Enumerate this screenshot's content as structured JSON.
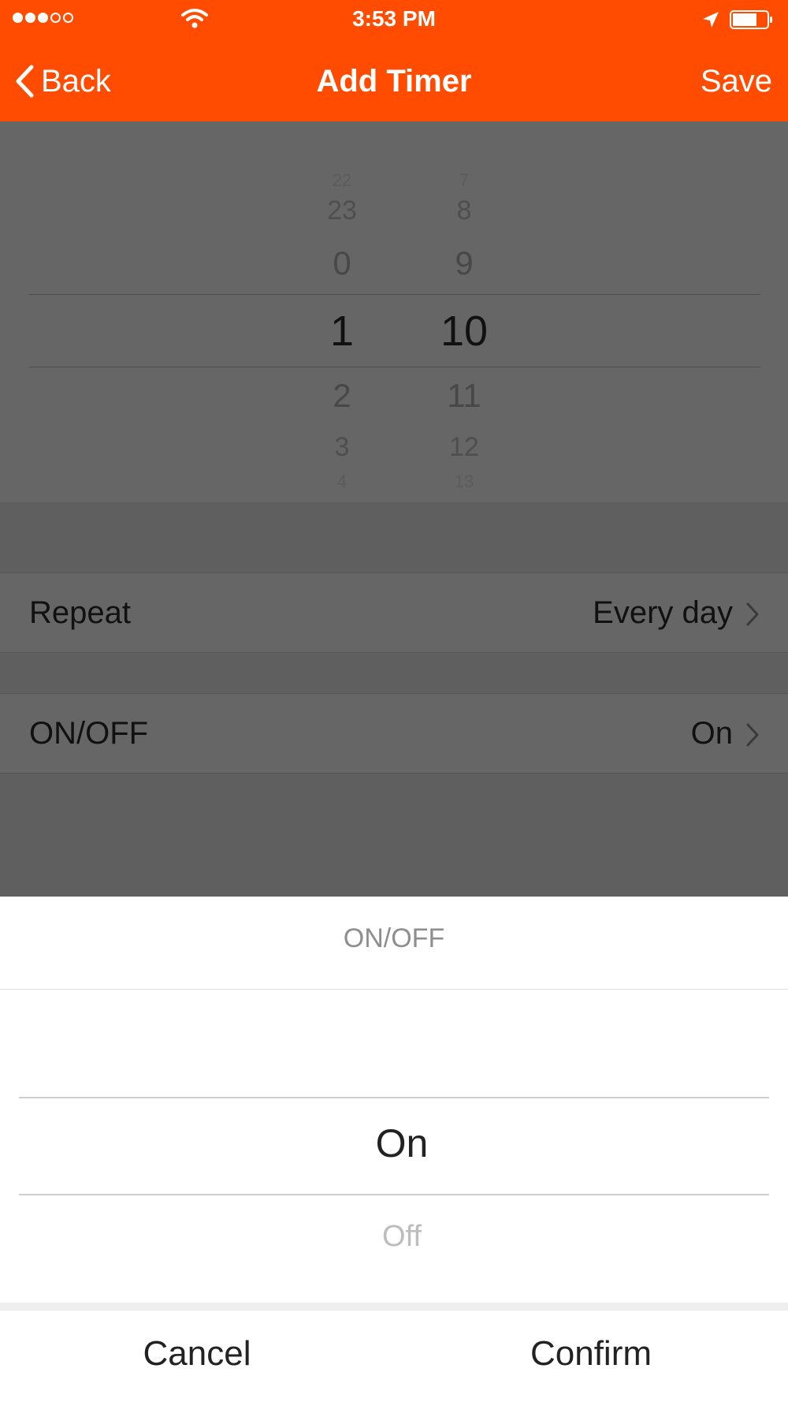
{
  "status_bar": {
    "time": "3:53 PM"
  },
  "nav": {
    "back_label": "Back",
    "title": "Add Timer",
    "save_label": "Save"
  },
  "time_picker": {
    "hours": [
      "22",
      "23",
      "0",
      "1",
      "2",
      "3",
      "4"
    ],
    "minutes": [
      "7",
      "8",
      "9",
      "10",
      "11",
      "12",
      "13"
    ],
    "selected_hour": "1",
    "selected_minute": "10"
  },
  "rows": {
    "repeat": {
      "label": "Repeat",
      "value": "Every day"
    },
    "onoff": {
      "label": "ON/OFF",
      "value": "On"
    }
  },
  "sheet": {
    "title": "ON/OFF",
    "options": [
      "On",
      "Off"
    ],
    "selected": "On",
    "cancel_label": "Cancel",
    "confirm_label": "Confirm"
  },
  "colors": {
    "accent": "#ff4c00"
  }
}
